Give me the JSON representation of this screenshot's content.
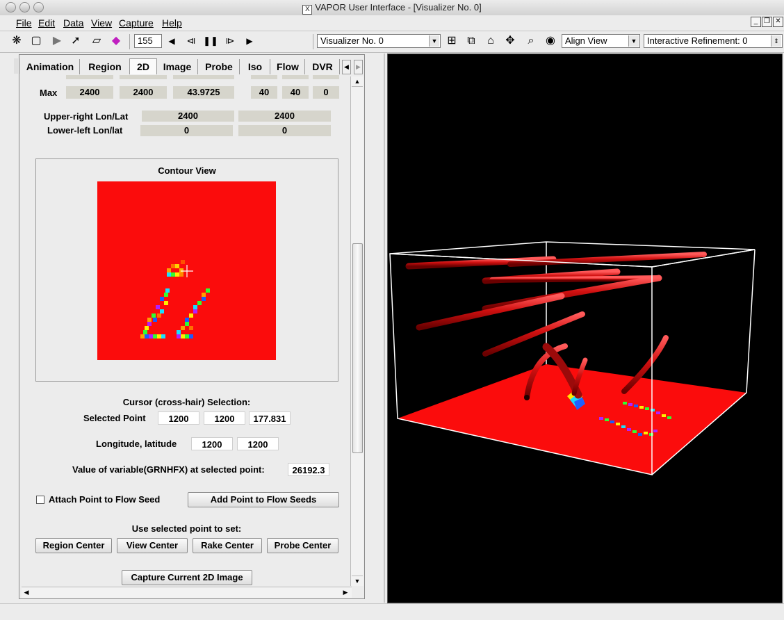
{
  "window": {
    "title": "VAPOR User Interface - [Visualizer No. 0]"
  },
  "menubar": [
    "File",
    "Edit",
    "Data",
    "View",
    "Capture",
    "Help"
  ],
  "toolbar": {
    "frame_value": "155",
    "visualizer_select": "Visualizer No. 0",
    "align_view_select": "Align View",
    "interactive_refinement": "Interactive Refinement: 0"
  },
  "tabs": [
    "Animation",
    "Region",
    "2D",
    "Image",
    "Probe",
    "Iso",
    "Flow",
    "DVR"
  ],
  "extents": {
    "max_label": "Max",
    "max_values": [
      "2400",
      "2400",
      "43.9725",
      "40",
      "40",
      "0"
    ],
    "upper_right_label": "Upper-right Lon/Lat",
    "upper_right_values": [
      "2400",
      "2400"
    ],
    "lower_left_label": "Lower-left Lon/lat",
    "lower_left_values": [
      "0",
      "0"
    ]
  },
  "contour": {
    "title": "Contour View"
  },
  "cursor": {
    "section_title": "Cursor (cross-hair) Selection:",
    "selected_point_label": "Selected Point",
    "selected_point": [
      "1200",
      "1200",
      "177.831"
    ],
    "lonlat_label": "Longitude, latitude",
    "lonlat": [
      "1200",
      "1200"
    ],
    "value_label": "Value of variable(GRNHFX) at selected point:",
    "value": "26192.3"
  },
  "flow": {
    "attach_label": "Attach Point to Flow Seed",
    "add_button": "Add Point to Flow Seeds"
  },
  "set_point": {
    "label": "Use selected point to set:",
    "buttons": [
      "Region Center",
      "View Center",
      "Rake Center",
      "Probe Center"
    ]
  },
  "capture_button": "Capture Current 2D Image",
  "colors": {
    "contour_red": "#fb0c0c",
    "tube_red": "#cc1010",
    "viewer_bg": "#000000"
  }
}
